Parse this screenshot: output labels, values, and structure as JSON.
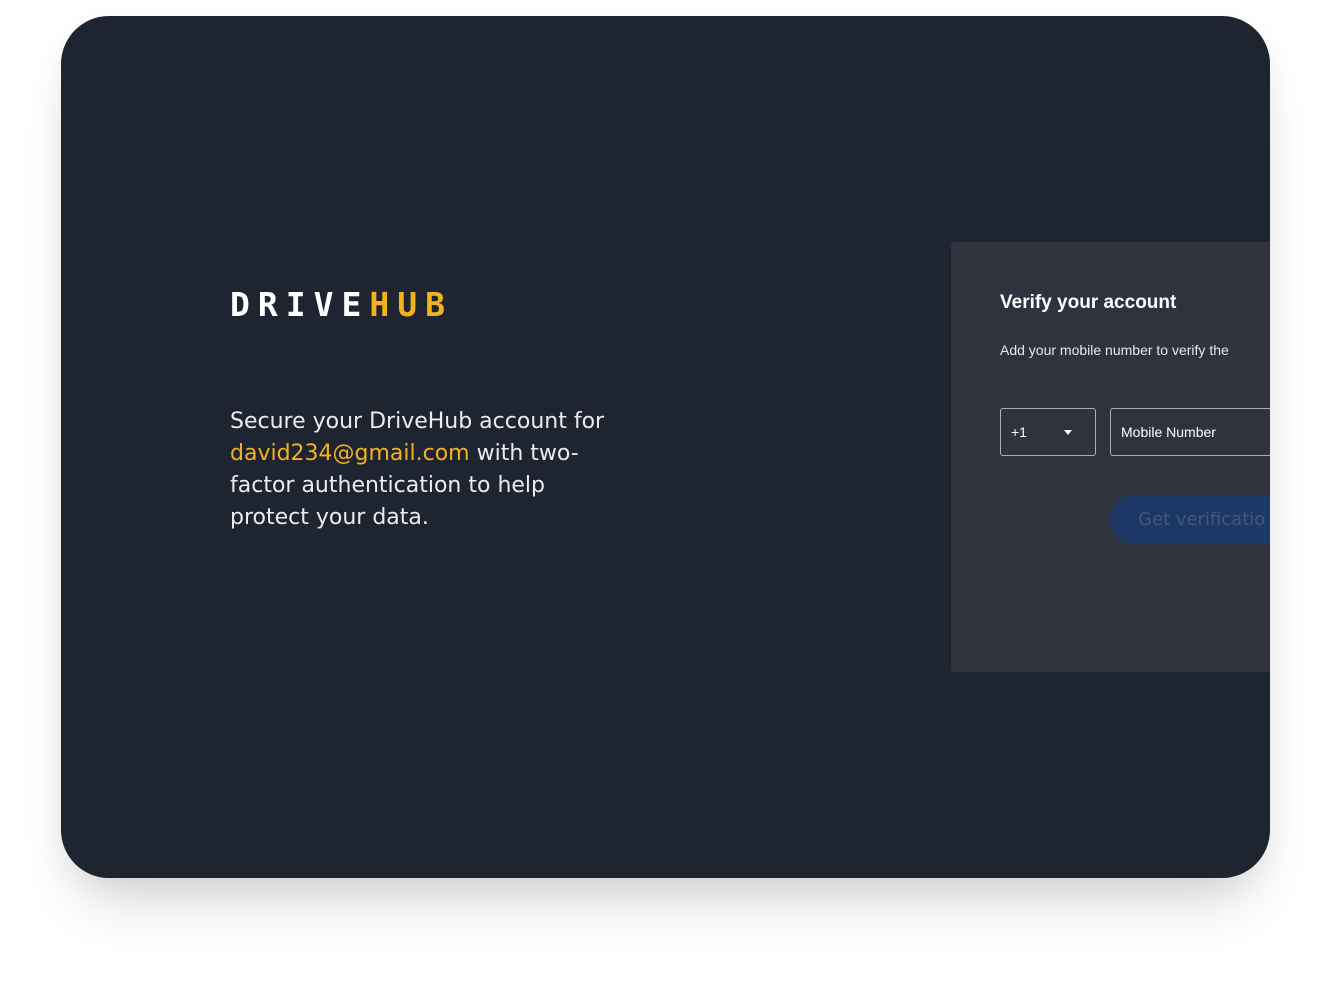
{
  "brand": {
    "name_part1": "DRIVE",
    "name_part2": "HUB",
    "accent_color": "#f2b21f"
  },
  "intro": {
    "text_before_email": "Secure your DriveHub account for ",
    "email": "david234@gmail.com",
    "text_after_email": " with two-factor authentication to help protect your data."
  },
  "verify_panel": {
    "title": "Verify your account",
    "description": "Add your mobile number to verify the",
    "country_code": "+1",
    "phone_placeholder": "Mobile Number",
    "submit_label": "Get verificatio"
  },
  "colors": {
    "background": "#1f2530",
    "panel": "#2e333e",
    "button": "#1b3866"
  }
}
